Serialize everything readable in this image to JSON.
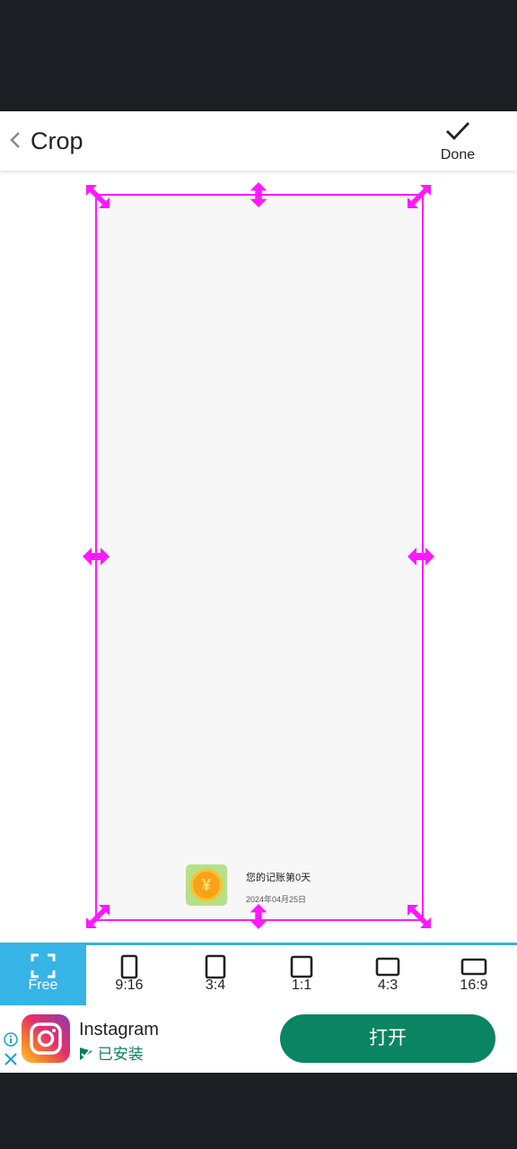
{
  "toolbar": {
    "title": "Crop",
    "done_label": "Done"
  },
  "image_content": {
    "title": "您的记账第0天",
    "date": "2024年04月25日",
    "coin_symbol": "¥"
  },
  "ratios": [
    {
      "label": "Free",
      "icon": "free-crop-icon",
      "active": true
    },
    {
      "label": "9:16",
      "icon": "ratio-9-16-icon",
      "active": false
    },
    {
      "label": "3:4",
      "icon": "ratio-3-4-icon",
      "active": false
    },
    {
      "label": "1:1",
      "icon": "ratio-1-1-icon",
      "active": false
    },
    {
      "label": "4:3",
      "icon": "ratio-4-3-icon",
      "active": false
    },
    {
      "label": "16:9",
      "icon": "ratio-16-9-icon",
      "active": false
    }
  ],
  "ad": {
    "app_name": "Instagram",
    "installed_label": "已安装",
    "button_label": "打开"
  },
  "colors": {
    "crop_frame": "#ff19ff",
    "accent": "#36b4e5",
    "ad_button": "#0b8462"
  }
}
